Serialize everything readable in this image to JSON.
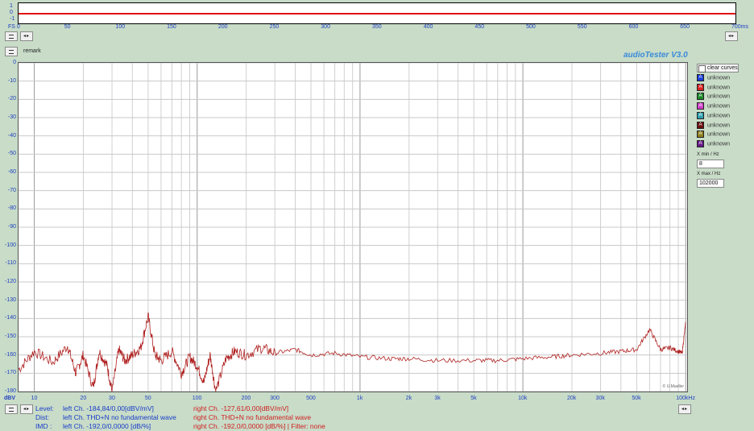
{
  "app": {
    "title": "audioTester  V3.0",
    "remark_label": "remark",
    "watermark": "© U.Mueller"
  },
  "scope": {
    "y_labels": [
      "1",
      "0",
      "-1"
    ],
    "x_labels": [
      "FS 0",
      "50",
      "100",
      "150",
      "200",
      "250",
      "300",
      "350",
      "400",
      "450",
      "500",
      "550",
      "600",
      "650",
      "700ms"
    ]
  },
  "legend": {
    "clear_label": "clear curves",
    "items": [
      {
        "letter": "A",
        "label": "unknown",
        "color": "#1a3cd8"
      },
      {
        "letter": "A",
        "label": "unknown",
        "color": "#d82020"
      },
      {
        "letter": "A",
        "label": "unknown",
        "color": "#1a8a2a"
      },
      {
        "letter": "A",
        "label": "unknown",
        "color": "#d040c8"
      },
      {
        "letter": "A",
        "label": "unknown",
        "color": "#30a0b0"
      },
      {
        "letter": "A",
        "label": "unknown",
        "color": "#6a1010"
      },
      {
        "letter": "A",
        "label": "unknown",
        "color": "#908020"
      },
      {
        "letter": "A",
        "label": "unknown",
        "color": "#6a1a8a"
      }
    ],
    "xmin_label": "X min / Hz",
    "xmin_value": "8",
    "xmax_label": "X max / Hz",
    "xmax_value": "102000"
  },
  "chart_data": {
    "type": "line",
    "xscale": "log",
    "xlim": [
      8,
      102000
    ],
    "ylim": [
      -180,
      0
    ],
    "ylabel": "dBV",
    "xlabel": "",
    "grid": true,
    "y_ticks": [
      0,
      -10,
      -20,
      -30,
      -40,
      -50,
      -60,
      -70,
      -80,
      -90,
      -100,
      -110,
      -120,
      -130,
      -140,
      -150,
      -160,
      -170,
      -180
    ],
    "x_tick_labels": [
      "10",
      "20",
      "30",
      "50",
      "100",
      "200",
      "300",
      "500",
      "1k",
      "2k",
      "3k",
      "5k",
      "10k",
      "20k",
      "30k",
      "50k",
      "100kHz"
    ],
    "x_tick_values": [
      10,
      20,
      30,
      50,
      100,
      200,
      300,
      500,
      1000,
      2000,
      3000,
      5000,
      10000,
      20000,
      30000,
      50000,
      100000
    ],
    "series": [
      {
        "color": "#b02020",
        "x": [
          8,
          10,
          13,
          16,
          18,
          20,
          23,
          25,
          28,
          30,
          33,
          36,
          40,
          45,
          50,
          55,
          60,
          70,
          80,
          90,
          100,
          110,
          120,
          130,
          150,
          170,
          200,
          250,
          300,
          400,
          500,
          700,
          1000,
          1500,
          2000,
          3000,
          5000,
          7000,
          10000,
          15000,
          20000,
          30000,
          40000,
          50000,
          60000,
          70000,
          80000,
          90000,
          95000,
          100000
        ],
        "y": [
          -168,
          -158,
          -164,
          -155,
          -170,
          -160,
          -178,
          -158,
          -166,
          -180,
          -157,
          -163,
          -160,
          -156,
          -139,
          -160,
          -163,
          -158,
          -170,
          -161,
          -166,
          -175,
          -160,
          -180,
          -162,
          -158,
          -160,
          -156,
          -159,
          -157,
          -160,
          -159,
          -161,
          -162,
          -162,
          -163,
          -163,
          -163,
          -162,
          -161,
          -160,
          -159,
          -158,
          -157,
          -146,
          -157,
          -156,
          -158,
          -159,
          -142
        ]
      }
    ]
  },
  "bottom": {
    "dbv_label": "dBV",
    "level_label": "Level:",
    "level_left": "left Ch. -184,84/0,00[dBV/mV]",
    "level_right": "right Ch. -127,61/0,00[dBV/mV]",
    "dist_label": "Dist:",
    "dist_left": "left Ch. THD+N  no fundamental wave",
    "dist_right": "right Ch. THD+N  no fundamental wave",
    "imd_label": "IMD  :",
    "imd_left": "left Ch. -192,0/0,0000 [dB/%]",
    "imd_right": "right Ch. -192,0/0,0000 [dB/%] |   Filter: none"
  }
}
